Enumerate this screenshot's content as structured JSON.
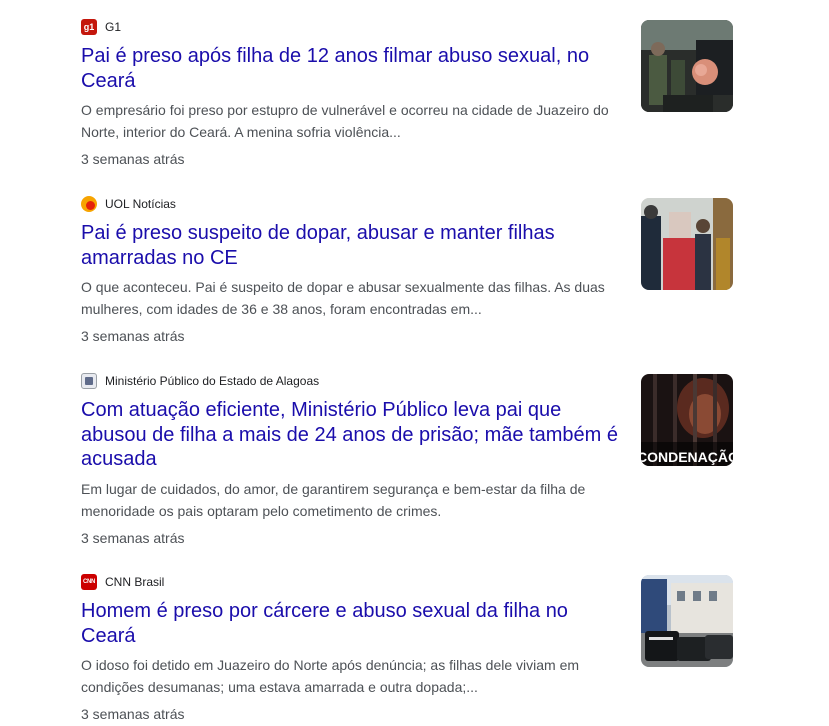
{
  "articles": [
    {
      "source": "G1",
      "source_icon": "g1-logo-icon",
      "source_icon_text": "g1",
      "headline": "Pai é preso após filha de 12 anos filmar abuso sexual, no Ceará",
      "snippet": "O empresário foi preso por estupro de vulnerável e ocorreu na cidade de Juazeiro do Norte, interior do Ceará. A menina sofria violência...",
      "time": "3 semanas atrás",
      "thumbnail": "police-arrest-photo"
    },
    {
      "source": "UOL Notícias",
      "source_icon": "uol-logo-icon",
      "source_icon_text": "",
      "headline": "Pai é preso suspeito de dopar, abusar e manter filhas amarradas no CE",
      "snippet": "O que aconteceu. Pai é suspeito de dopar e abusar sexualmente das filhas. As duas mulheres, com idades de 36 e 38 anos, foram encontradas em...",
      "time": "3 semanas atrás",
      "thumbnail": "suspect-escorted-photo"
    },
    {
      "source": "Ministério Público do Estado de Alagoas",
      "source_icon": "mp-alagoas-logo-icon",
      "source_icon_text": "",
      "headline": "Com atuação eficiente, Ministério Público leva pai que abusou de filha a mais de 24 anos de prisão; mãe também é acusada",
      "snippet": "Em lugar de cuidados, do amor, de garantirem segurança e bem-estar da filha de menoridade os pais optaram pelo cometimento de crimes.",
      "time": "3 semanas atrás",
      "thumbnail": "prison-bars-photo",
      "thumbnail_caption": "CONDENAÇÃO"
    },
    {
      "source": "CNN Brasil",
      "source_icon": "cnn-logo-icon",
      "source_icon_text": "CNN",
      "headline": "Homem é preso por cárcere e abuso sexual da filha no Ceará",
      "snippet": "O idoso foi detido em Juazeiro do Norte após denúncia; as filhas dele viviam em condições desumanas; uma estava amarrada e outra dopada;...",
      "time": "3 semanas atrás",
      "thumbnail": "police-vehicles-photo"
    }
  ]
}
